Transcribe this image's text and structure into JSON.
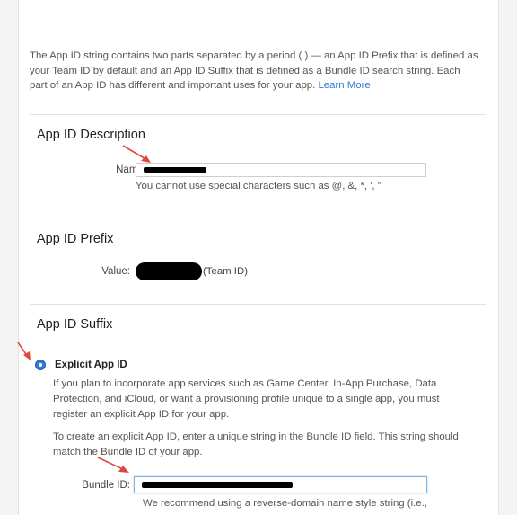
{
  "intro": {
    "text": "The App ID string contains two parts separated by a period (.) — an App ID Prefix that is defined as your Team ID by default and an App ID Suffix that is defined as a Bundle ID search string. Each part of an App ID has different and important uses for your app.",
    "link_label": "Learn More"
  },
  "description": {
    "title": "App ID Description",
    "name_label": "Name:",
    "name_value": "",
    "hint": "You cannot use special characters such as @, &, *, ', \""
  },
  "prefix": {
    "title": "App ID Prefix",
    "value_label": "Value:",
    "team_suffix": "(Team ID)"
  },
  "suffix": {
    "title": "App ID Suffix",
    "explicit_label": "Explicit App ID",
    "explicit_selected": true,
    "explicit_desc": "If you plan to incorporate app services such as Game Center, In-App Purchase, Data Protection, and iCloud, or want a provisioning profile unique to a single app, you must register an explicit App ID for your app.",
    "explicit_instructions": "To create an explicit App ID, enter a unique string in the Bundle ID field. This string should match the Bundle ID of your app.",
    "bundle_label": "Bundle ID:",
    "bundle_value": "",
    "bundle_hint": "We recommend using a reverse-domain name style string (i.e.,"
  },
  "colors": {
    "link": "#2f7bd6",
    "annotation_arrow": "#e0483c",
    "radio_selected": "#2f7bd6"
  }
}
